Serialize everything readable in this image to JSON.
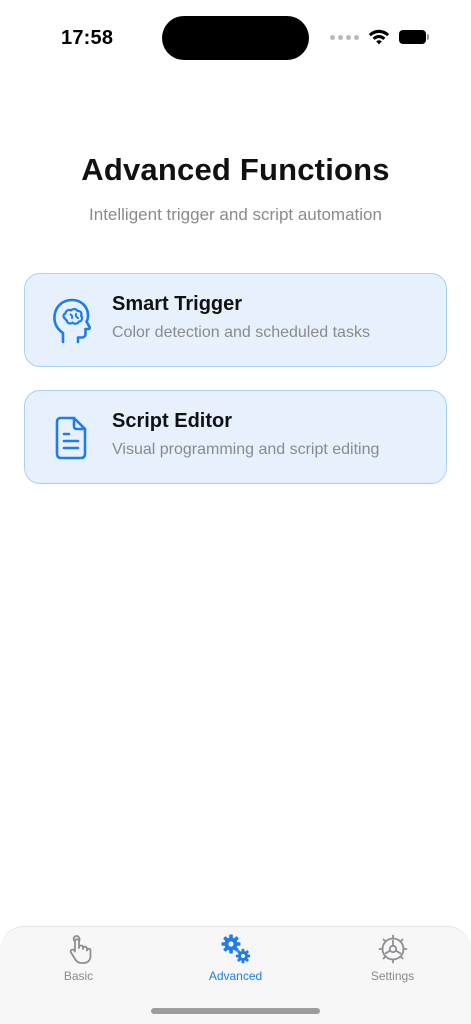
{
  "status_bar": {
    "time": "17:58"
  },
  "header": {
    "title": "Advanced Functions",
    "subtitle": "Intelligent trigger and script automation"
  },
  "features": [
    {
      "title": "Smart Trigger",
      "description": "Color detection and scheduled tasks",
      "icon": "brain-head-icon"
    },
    {
      "title": "Script Editor",
      "description": "Visual programming and script editing",
      "icon": "document-icon"
    }
  ],
  "tab_bar": {
    "tabs": [
      {
        "label": "Basic",
        "icon": "hand-tap-icon",
        "active": false
      },
      {
        "label": "Advanced",
        "icon": "gears-icon",
        "active": true
      },
      {
        "label": "Settings",
        "icon": "gear-icon",
        "active": false
      }
    ]
  },
  "colors": {
    "accent": "#1f7ce8",
    "card_background": "#e6f1fd",
    "card_border": "#a9d1f5",
    "secondary_text": "#8a8a8e",
    "inactive_icon": "#8e8e93"
  }
}
